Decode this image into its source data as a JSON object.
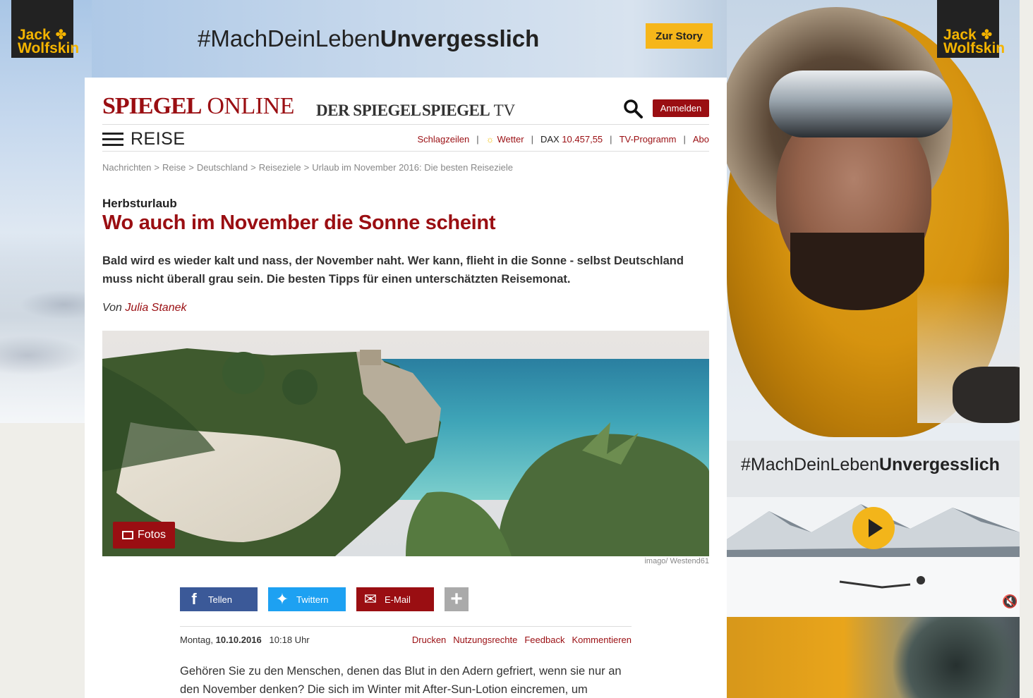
{
  "ad": {
    "brand_line1": "Jack",
    "brand_line2": "Wolfskin",
    "tag_regular": "#MachDeinLeben",
    "tag_bold": "Unvergesslich",
    "cta": "Zur Story",
    "brand_color": "#f6b61a"
  },
  "header": {
    "logo_spiegel": "SPIEGEL",
    "logo_online": "ONLINE",
    "logo_der_spiegel": "DER SPIEGEL",
    "logo_spiegel_tv_a": "SPIEGEL",
    "logo_spiegel_tv_b": "TV",
    "login": "Anmelden",
    "accent_color": "#9a0e12"
  },
  "nav": {
    "section": "REISE",
    "schlagzeilen": "Schlagzeilen",
    "wetter": "Wetter",
    "dax_label": "DAX",
    "dax_value": "10.457,55",
    "tv_programm": "TV-Programm",
    "abo": "Abo",
    "separator": "|"
  },
  "breadcrumb": {
    "items": [
      "Nachrichten",
      "Reise",
      "Deutschland",
      "Reiseziele",
      "Urlaub im November 2016: Die besten Reiseziele"
    ],
    "separator": ">"
  },
  "article": {
    "kicker": "Herbsturlaub",
    "title": "Wo auch im November die Sonne scheint",
    "teaser": "Bald wird es wieder kalt und nass, der November naht. Wer kann, flieht in die Sonne - selbst Deutschland muss nicht überall grau sein. Die besten Tipps für einen unterschätzten Reisemonat.",
    "byline_prefix": "Von",
    "author": "Julia Stanek",
    "photo_button": "Fotos",
    "photo_credit": "imago/ Westend61",
    "share_facebook": "Tellen",
    "share_twitter": "Twittern",
    "share_email": "E-Mail",
    "share_more": "+",
    "date_prefix": "Montag,",
    "date": "10.10.2016",
    "time": "10:18 Uhr",
    "actions": [
      "Drucken",
      "Nutzungsrechte",
      "Feedback",
      "Kommentieren"
    ],
    "body": "Gehören Sie zu den Menschen, denen das Blut in den Adern gefriert, wenn sie nur an den November denken? Die sich im Winter mit After-Sun-Lotion eincremen, um"
  },
  "video_ad": {
    "tag_regular": "#MachDeinLeben",
    "tag_bold": "Unvergesslich",
    "mute_icon": "speaker-muted-icon"
  }
}
